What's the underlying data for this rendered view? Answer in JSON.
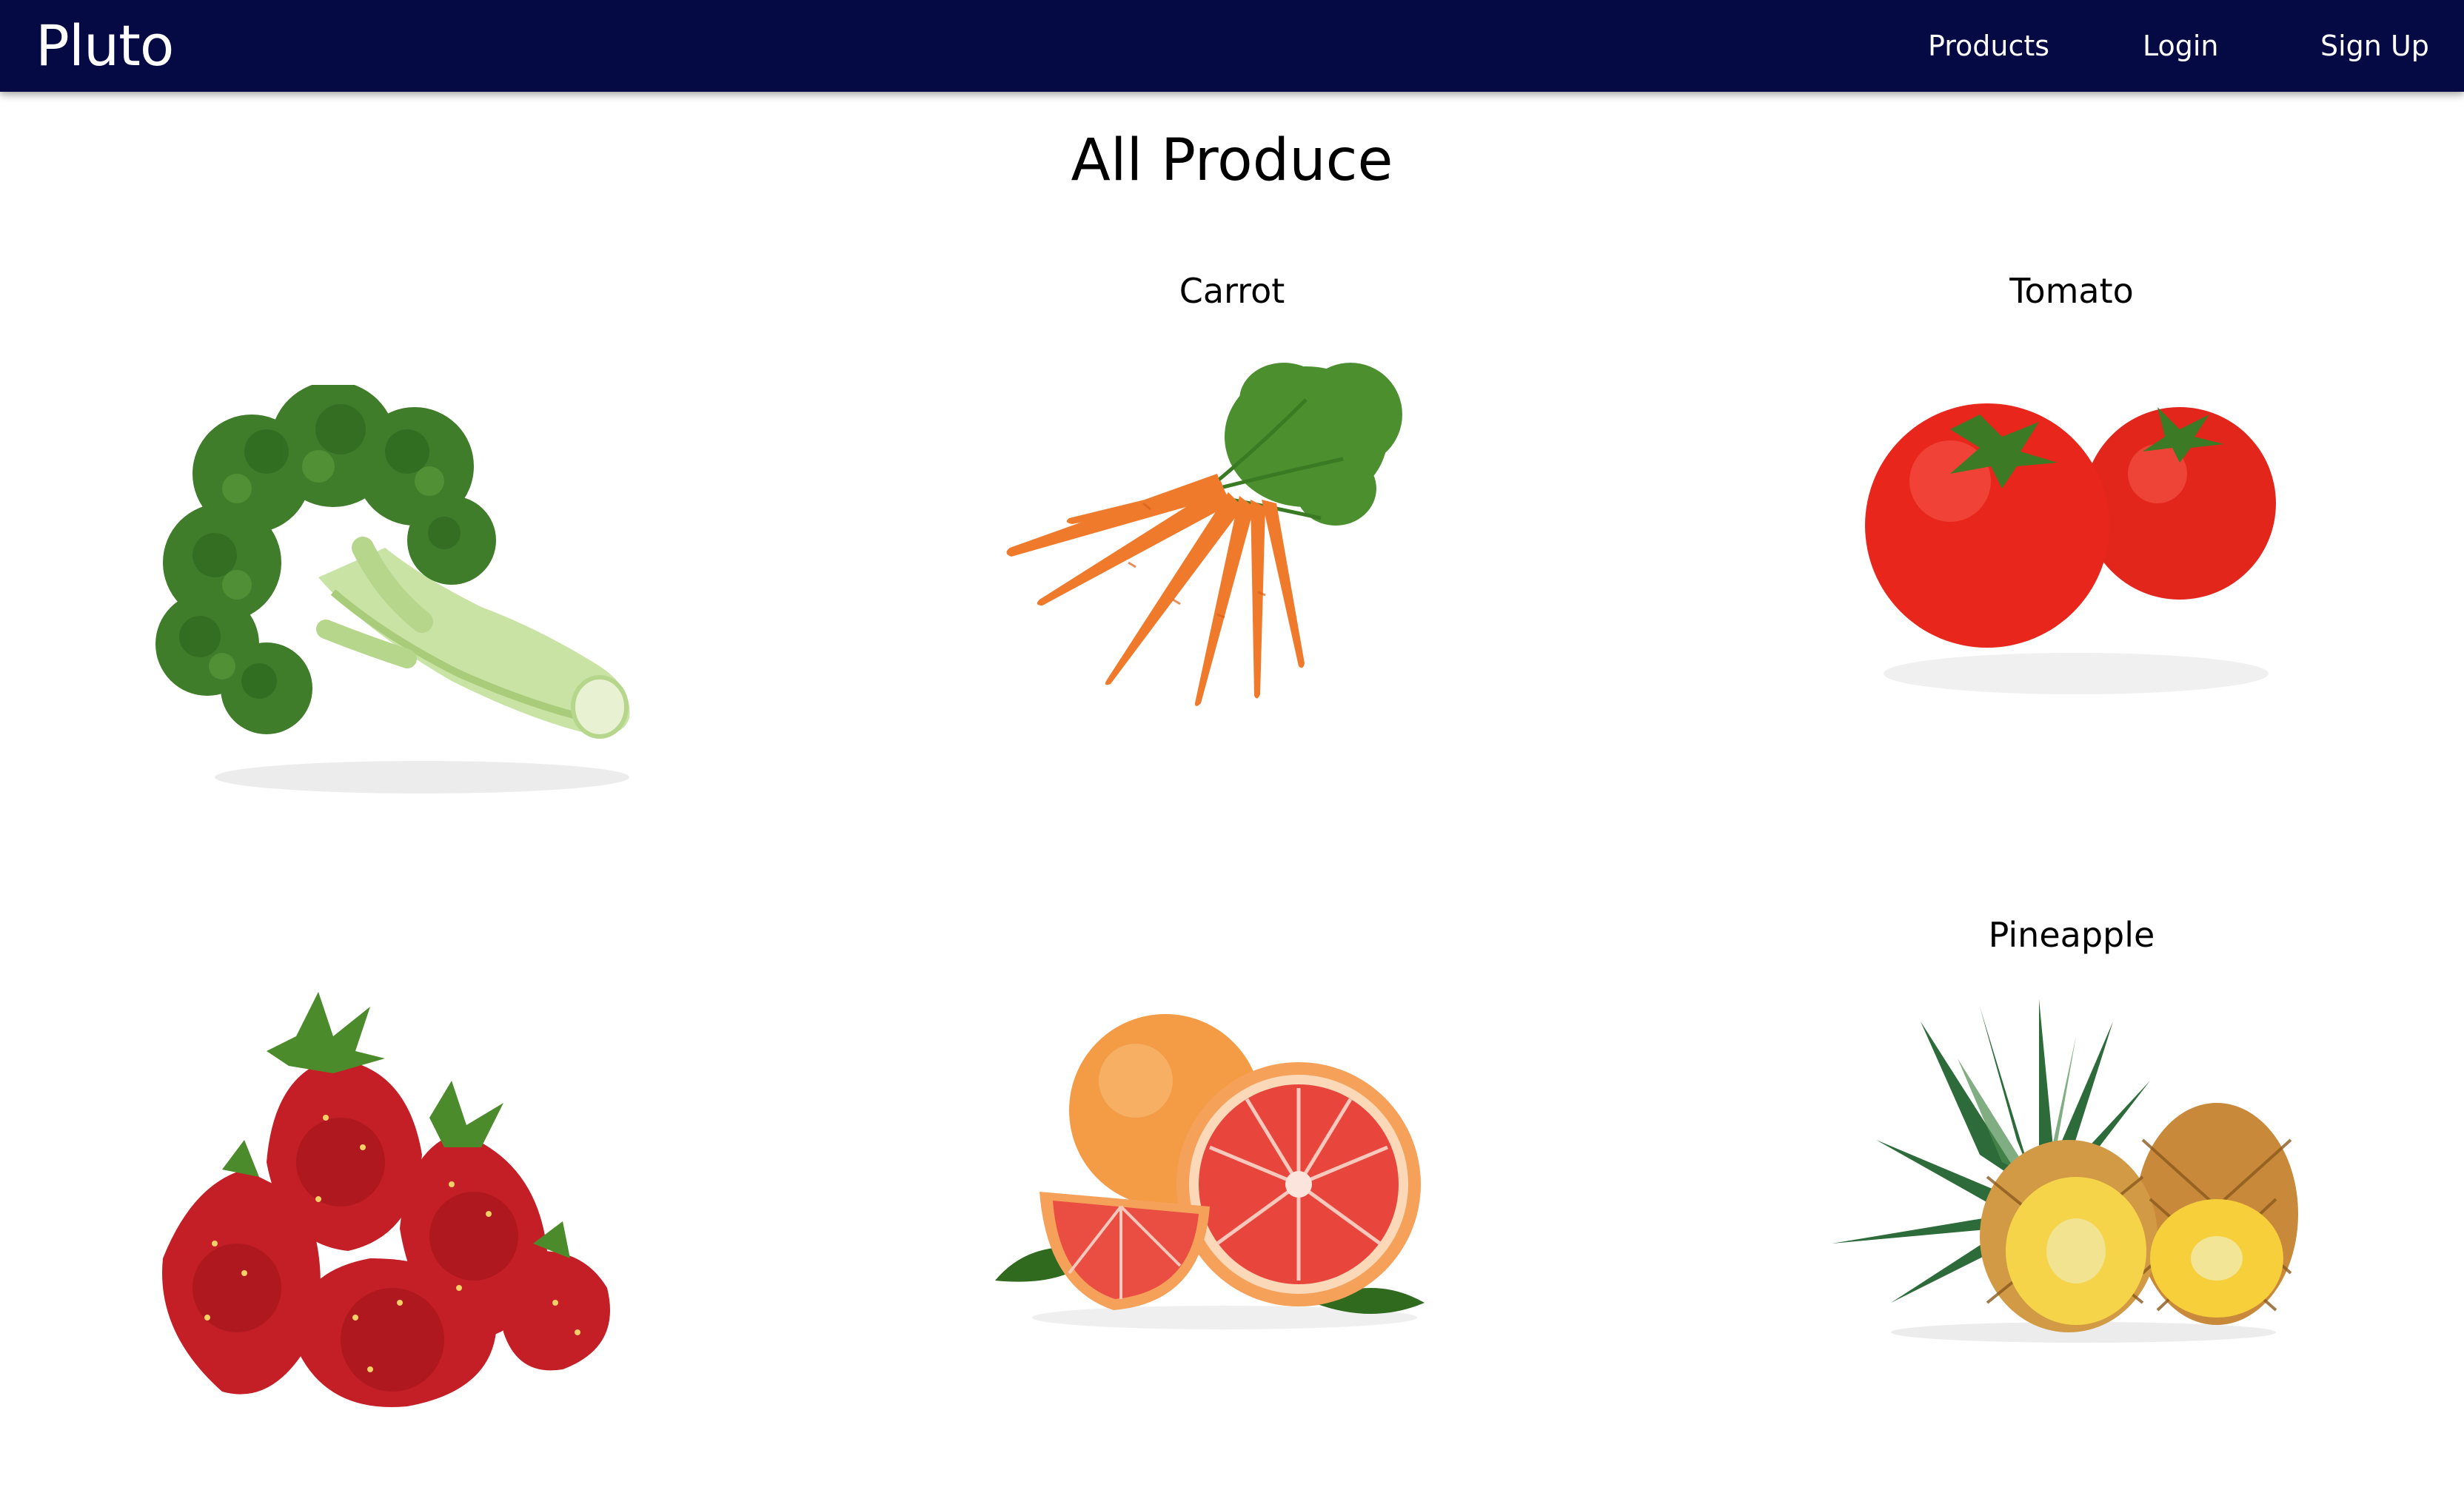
{
  "navbar": {
    "brand": "Pluto",
    "links": [
      {
        "label": "Products"
      },
      {
        "label": "Login"
      },
      {
        "label": "Sign Up"
      }
    ]
  },
  "page": {
    "title": "All Produce"
  },
  "products": [
    {
      "name": "",
      "image": "broccoli"
    },
    {
      "name": "Carrot",
      "image": "carrot"
    },
    {
      "name": "Tomato",
      "image": "tomato"
    },
    {
      "name": "",
      "image": "strawberry"
    },
    {
      "name": "",
      "image": "grapefruit"
    },
    {
      "name": "Pineapple",
      "image": "pineapple"
    }
  ],
  "colors": {
    "navbar_bg": "#050a45",
    "nav_text": "#ffffff",
    "page_bg": "#ffffff"
  }
}
